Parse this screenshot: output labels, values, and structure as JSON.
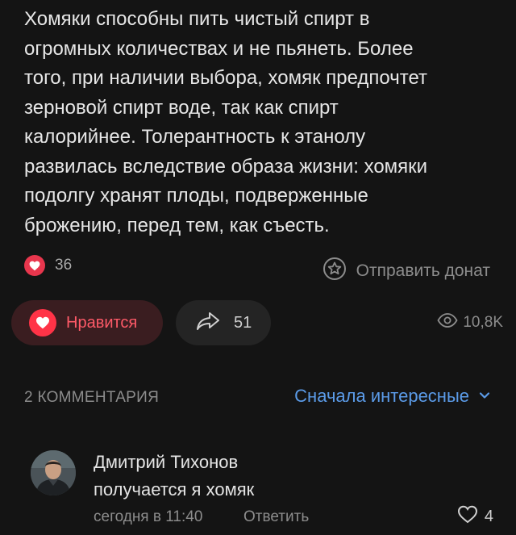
{
  "post": {
    "text_lines": [
      "Хомяки способны пить чистый спирт в",
      "огромных количествах и не пьянеть. Более",
      "того, при наличии выбора, хомяк предпочтет",
      "зерновой спирт воде, так как спирт",
      "калорийнее. Толерантность к этанолу",
      "развилась вследствие образа жизни: хомяки",
      "подолгу хранят плоды, подверженные",
      "брожению, перед тем, как съесть."
    ]
  },
  "reactions": {
    "count": "36",
    "donate_label": "Отправить донат"
  },
  "actions": {
    "like_label": "Нравится",
    "share_count": "51",
    "views": "10,8K"
  },
  "comments": {
    "count_label": "2 КОММЕНТАРИЯ",
    "sort_label": "Сначала интересные"
  },
  "comment": {
    "author": "Дмитрий Тихонов",
    "text": "получается я хомяк",
    "time": "сегодня в 11:40",
    "reply_label": "Ответить",
    "likes": "4"
  },
  "colors": {
    "accent_red": "#ff3347",
    "link_blue": "#5b9be8",
    "background": "#141414"
  },
  "icons": [
    "heart-icon",
    "donate-icon",
    "share-icon",
    "eye-icon",
    "chevron-down-icon",
    "heart-outline-icon"
  ]
}
